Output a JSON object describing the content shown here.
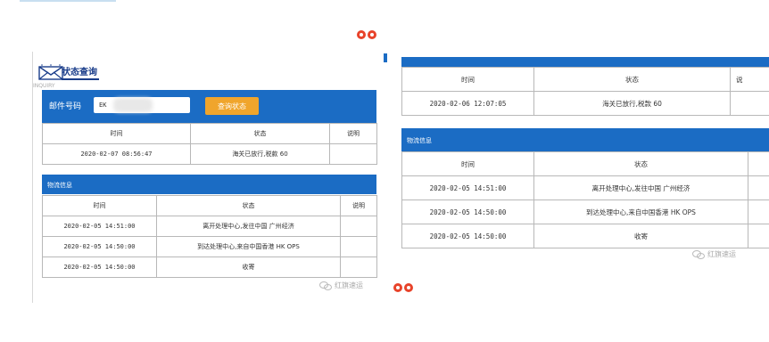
{
  "left": {
    "title": "状态查询",
    "subtitle": "INQUIRY",
    "form": {
      "label": "邮件号码",
      "tracking_prefix": "EK",
      "tracking_suffix": "HK",
      "query_button": "查询状态"
    },
    "status_table": {
      "headers": [
        "时间",
        "状态",
        "说明"
      ],
      "rows": [
        [
          "2020-02-07 08:56:47",
          "海关已放行,税款 60",
          ""
        ]
      ]
    },
    "logistics": {
      "title": "物流信息",
      "headers": [
        "时间",
        "状态",
        "说明"
      ],
      "rows": [
        [
          "2020-02-05 14:51:00",
          "离开处理中心,发往中国 广州经济",
          ""
        ],
        [
          "2020-02-05 14:50:00",
          "到达处理中心,来自中国香港 HK OPS",
          ""
        ],
        [
          "2020-02-05 14:50:00",
          "收寄",
          ""
        ]
      ]
    },
    "watermark": "红旗速运"
  },
  "right": {
    "status_table": {
      "headers": [
        "时间",
        "状态",
        "说"
      ],
      "rows": [
        [
          "2020-02-06 12:07:05",
          "海关已放行,税款 60",
          ""
        ]
      ]
    },
    "logistics": {
      "title": "物流信息",
      "headers": [
        "时间",
        "状态",
        ""
      ],
      "rows": [
        [
          "2020-02-05 14:51:00",
          "离开处理中心,发往中国 广州经济",
          ""
        ],
        [
          "2020-02-05 14:50:00",
          "到达处理中心,来自中国香港 HK OPS",
          ""
        ],
        [
          "2020-02-05 14:50:00",
          "收寄",
          ""
        ]
      ]
    },
    "watermark": "红旗速运"
  },
  "colors": {
    "primary_blue": "#1b6cc4",
    "button_orange": "#f0a52c",
    "pager_red": "#e8432a"
  }
}
